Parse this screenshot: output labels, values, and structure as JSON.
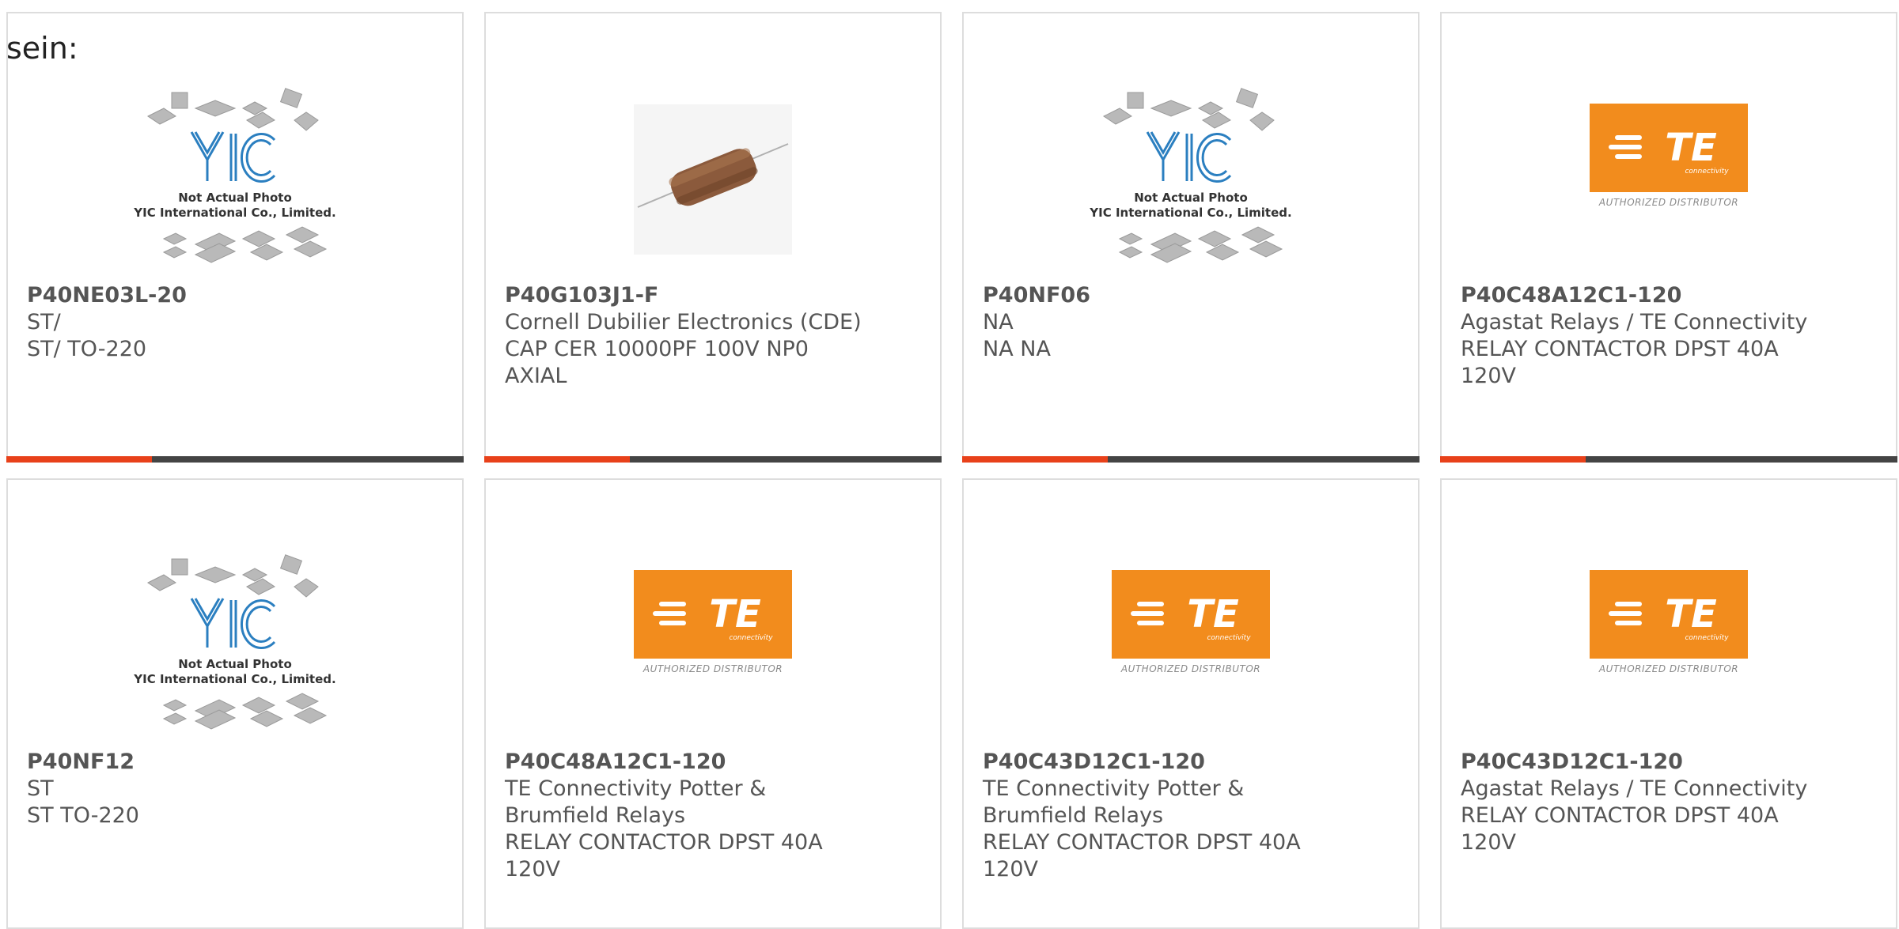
{
  "page": {
    "prefix_text": "sein:"
  },
  "brand_colors": {
    "accent": "#e8411a",
    "bar": "#444444",
    "te_orange": "#f28c1d",
    "yic_blue": "#2b7fc0",
    "text": "#555555"
  },
  "yic_placeholder": {
    "logo": "YIC",
    "line1": "Not Actual Photo",
    "line2": "YIC International Co., Limited."
  },
  "te_logo": {
    "mark": "TE",
    "sub": "connectivity",
    "tag": "AUTHORIZED DISTRIBUTOR"
  },
  "products": [
    {
      "part": "P40NE03L-20",
      "line2": "ST/",
      "line3": "ST/ TO-220",
      "line4": "",
      "image": "yic-placeholder-image"
    },
    {
      "part": "P40G103J1-F",
      "line2": "Cornell Dubilier Electronics (CDE)",
      "line3": "CAP CER 10000PF 100V NP0",
      "line4": "AXIAL",
      "image": "capacitor-image"
    },
    {
      "part": "P40NF06",
      "line2": "NA",
      "line3": "NA NA",
      "line4": "",
      "image": "yic-placeholder-image"
    },
    {
      "part": "P40C48A12C1-120",
      "line2": "Agastat Relays / TE Connectivity",
      "line3": "RELAY CONTACTOR DPST 40A",
      "line4": "120V",
      "image": "te-logo-image"
    },
    {
      "part": "P40NF12",
      "line2": "ST",
      "line3": "ST TO-220",
      "line4": "",
      "image": "yic-placeholder-image"
    },
    {
      "part": "P40C48A12C1-120",
      "line2": "TE Connectivity Potter &",
      "line3": "Brumfield Relays",
      "line4": "RELAY CONTACTOR DPST 40A",
      "line5": "120V",
      "image": "te-logo-image"
    },
    {
      "part": "P40C43D12C1-120",
      "line2": "TE Connectivity Potter &",
      "line3": "Brumfield Relays",
      "line4": "RELAY CONTACTOR DPST 40A",
      "line5": "120V",
      "image": "te-logo-image"
    },
    {
      "part": "P40C43D12C1-120",
      "line2": "Agastat Relays / TE Connectivity",
      "line3": "RELAY CONTACTOR DPST 40A",
      "line4": "120V",
      "image": "te-logo-image"
    }
  ]
}
